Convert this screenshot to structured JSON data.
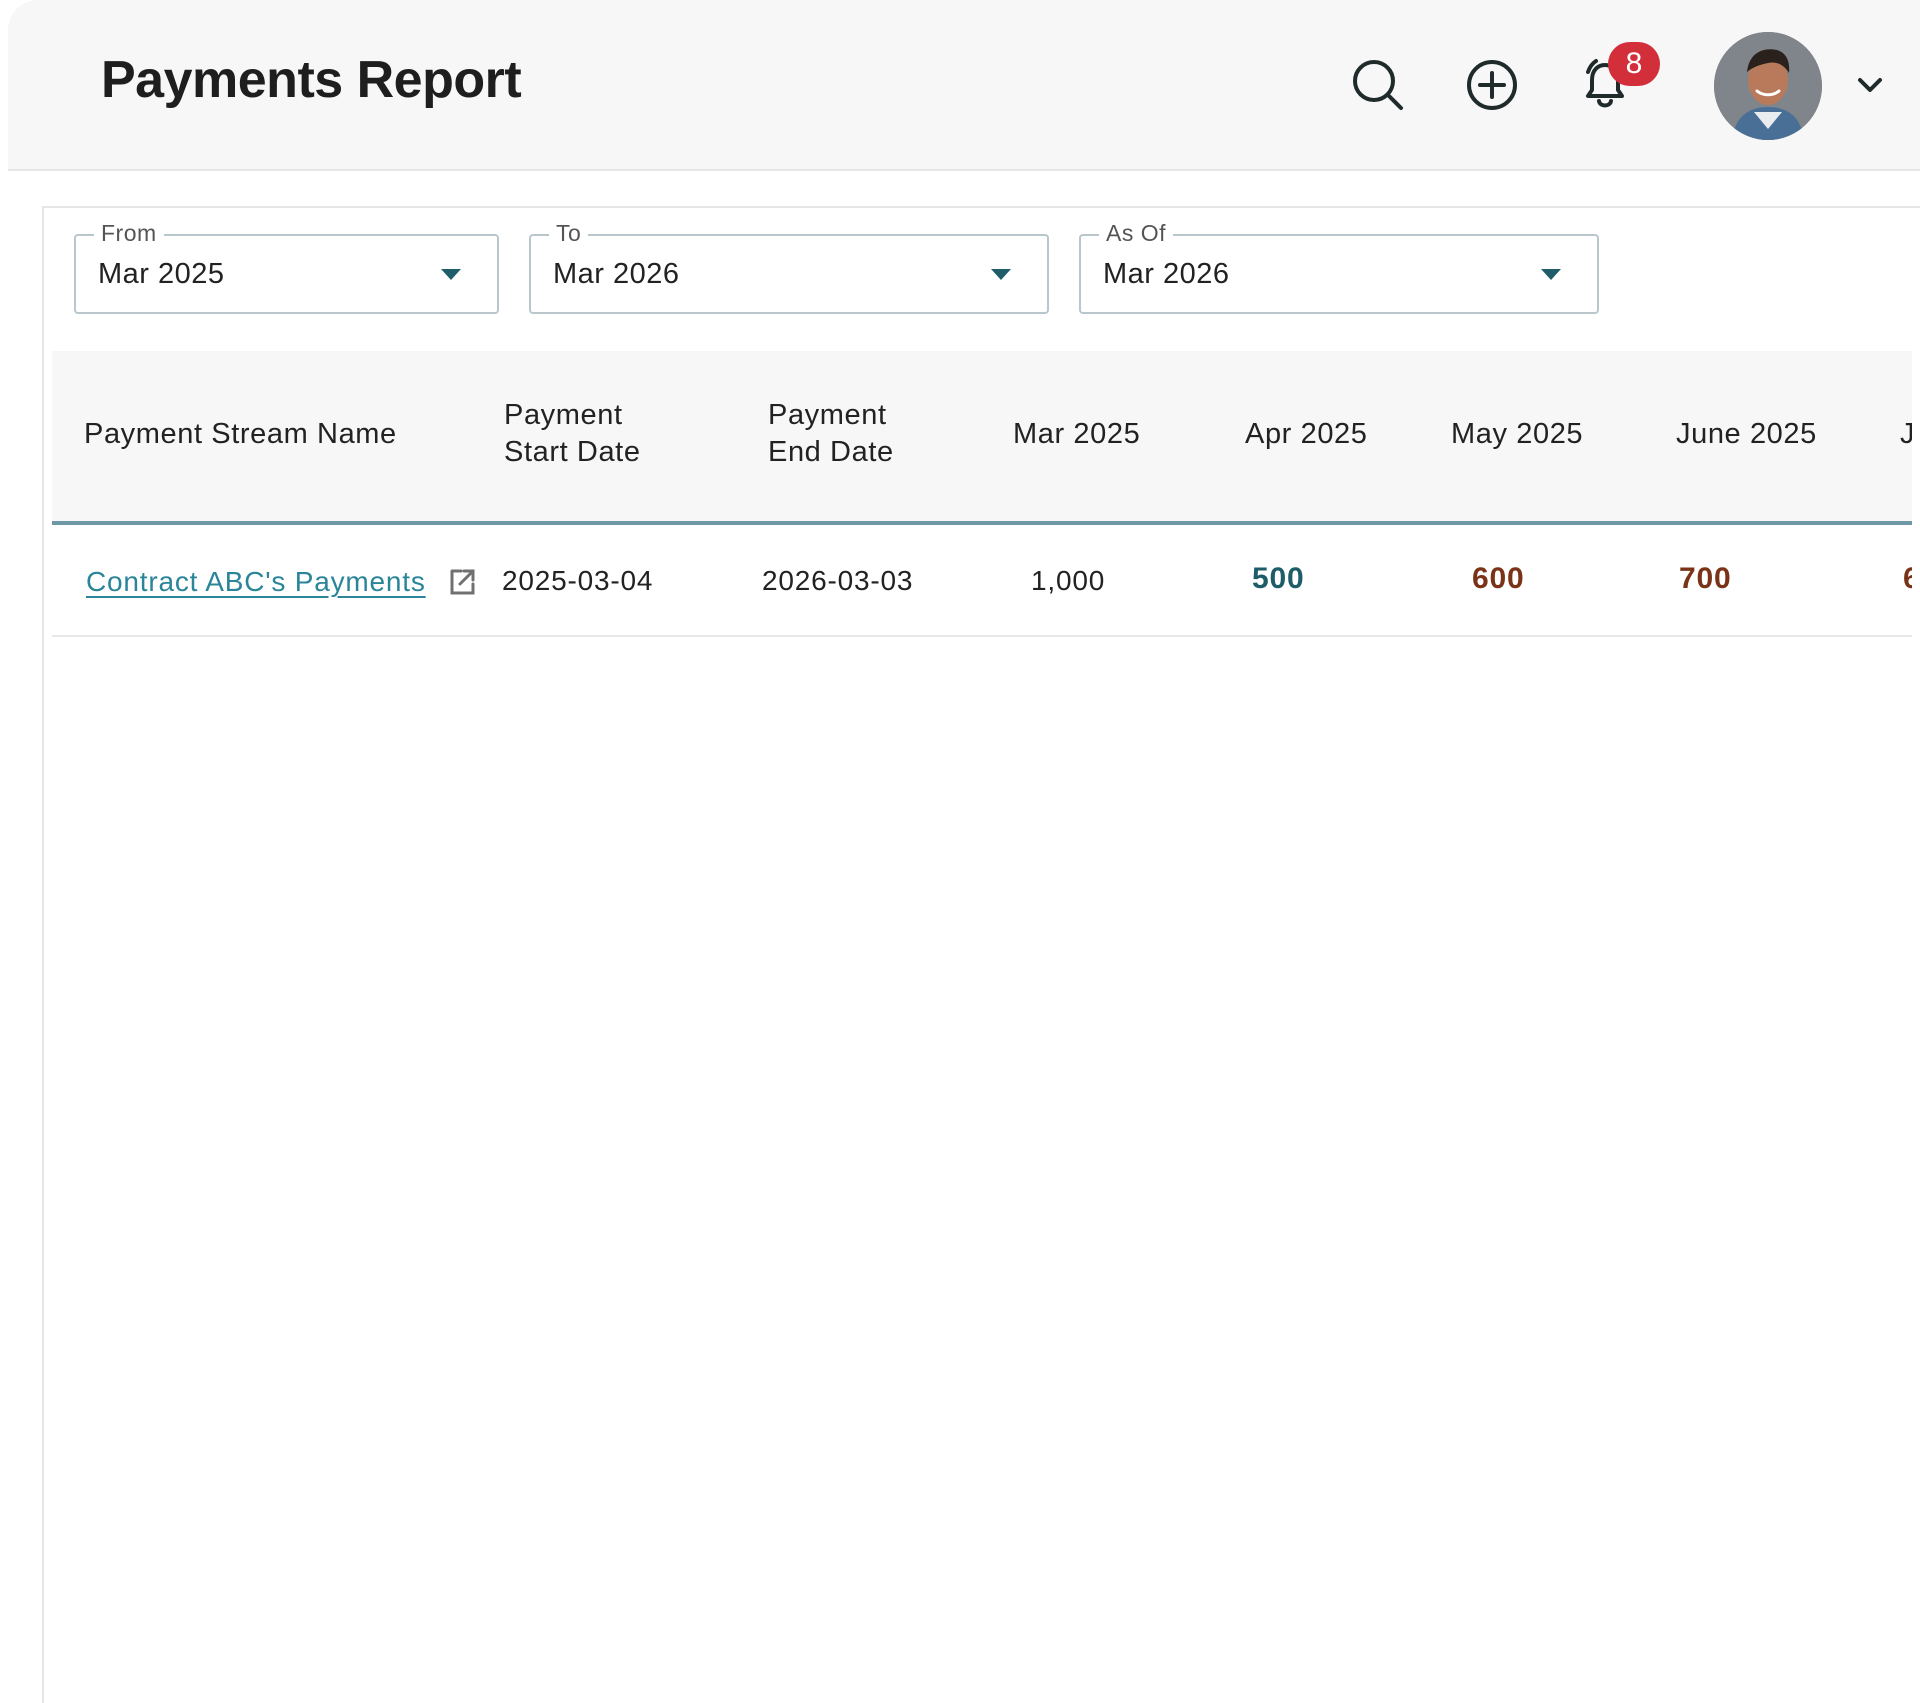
{
  "header": {
    "title": "Payments Report",
    "notifications_count": "8",
    "icons": [
      "search-icon",
      "add-circle-icon",
      "bell-icon",
      "chevron-down-icon"
    ],
    "accent": "#1f5d6a",
    "badge_color": "#d32f3a"
  },
  "filters": {
    "from": {
      "label": "From",
      "value": "Mar 2025"
    },
    "to": {
      "label": "To",
      "value": "Mar 2026"
    },
    "as_of": {
      "label": "As Of",
      "value": "Mar 2026"
    }
  },
  "table": {
    "columns": [
      "Payment Stream Name",
      "Payment",
      "Start Date",
      "Payment",
      "End Date",
      "Mar 2025",
      "Apr 2025",
      "May 2025",
      "June 2025",
      "J"
    ],
    "rows": [
      {
        "name": "Contract ABC's Payments",
        "start_date": "2025-03-04",
        "end_date": "2026-03-03",
        "mar_2025": "1,000",
        "apr_2025": "500",
        "may_2025": "600",
        "june_2025": "700",
        "next_partial": "6"
      }
    ],
    "colors": {
      "apr_value": "#1e5c68",
      "may_value": "#7a3316",
      "june_value": "#7a3316",
      "link": "#2a8598"
    }
  }
}
